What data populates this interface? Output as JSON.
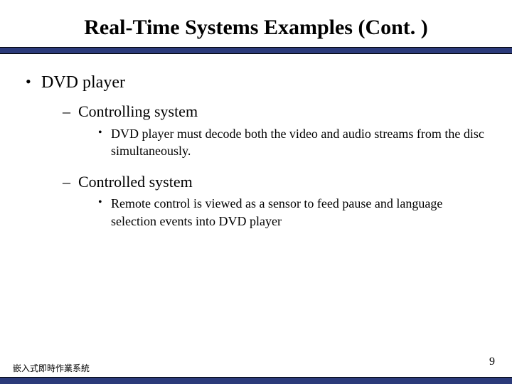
{
  "title": "Real-Time Systems Examples (Cont. )",
  "bullets": {
    "l1_0": "DVD player",
    "l2_0": "Controlling system",
    "l3_0": "DVD player must decode both the video and audio streams from the disc simultaneously.",
    "l2_1": "Controlled system",
    "l3_1": "Remote control is viewed as a sensor to feed pause and language selection events into DVD player"
  },
  "footer_left": "嵌入式即時作業系統",
  "page_number": "9"
}
